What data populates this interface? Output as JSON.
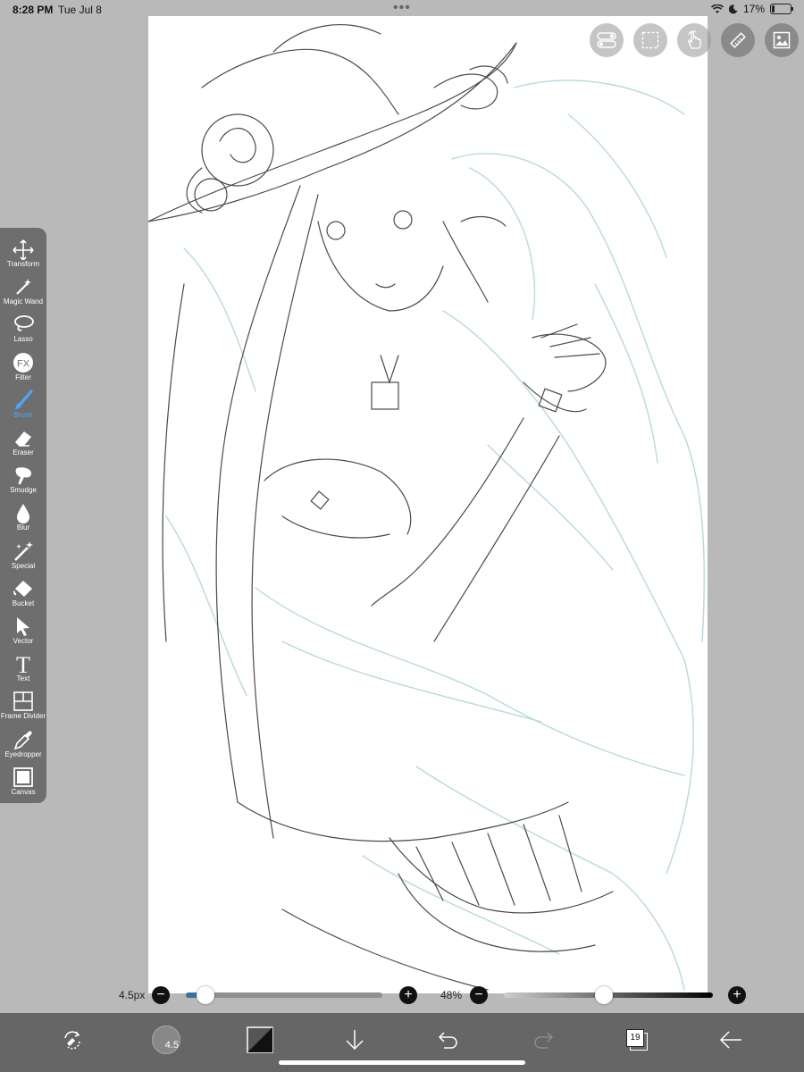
{
  "status": {
    "time": "8:28 PM",
    "date": "Tue Jul 8",
    "battery_text": "17%",
    "battery_level": 0.17
  },
  "top_buttons": [
    {
      "name": "settings-toggle-icon"
    },
    {
      "name": "selection-icon"
    },
    {
      "name": "gesture-icon"
    },
    {
      "name": "ruler-icon"
    },
    {
      "name": "gallery-icon"
    }
  ],
  "tools": [
    {
      "label": "Transform",
      "icon": "move-icon"
    },
    {
      "label": "Magic Wand",
      "icon": "magic-wand-icon"
    },
    {
      "label": "Lasso",
      "icon": "lasso-icon"
    },
    {
      "label": "Filter",
      "icon": "fx-icon"
    },
    {
      "label": "Brush",
      "icon": "brush-icon",
      "active": true
    },
    {
      "label": "Eraser",
      "icon": "eraser-icon"
    },
    {
      "label": "Smudge",
      "icon": "smudge-icon"
    },
    {
      "label": "Blur",
      "icon": "drop-icon"
    },
    {
      "label": "Special",
      "icon": "special-icon"
    },
    {
      "label": "Bucket",
      "icon": "bucket-icon"
    },
    {
      "label": "Vector",
      "icon": "cursor-icon"
    },
    {
      "label": "Text",
      "icon": "text-icon"
    },
    {
      "label": "Frame Divider",
      "icon": "frame-icon"
    },
    {
      "label": "Eyedropper",
      "icon": "eyedropper-icon"
    },
    {
      "label": "Canvas",
      "icon": "canvas-icon"
    }
  ],
  "sliders": {
    "brush_size_label": "4.5px",
    "brush_size_fraction": 0.1,
    "opacity_label": "48%",
    "opacity_fraction": 0.48,
    "minus": "−",
    "plus": "+"
  },
  "bottom": {
    "brush_size_badge": "4.5",
    "layers_count": "19"
  },
  "colors": {
    "active_tool": "#4aa6ff",
    "slider_fill": "#3a6ea5"
  }
}
